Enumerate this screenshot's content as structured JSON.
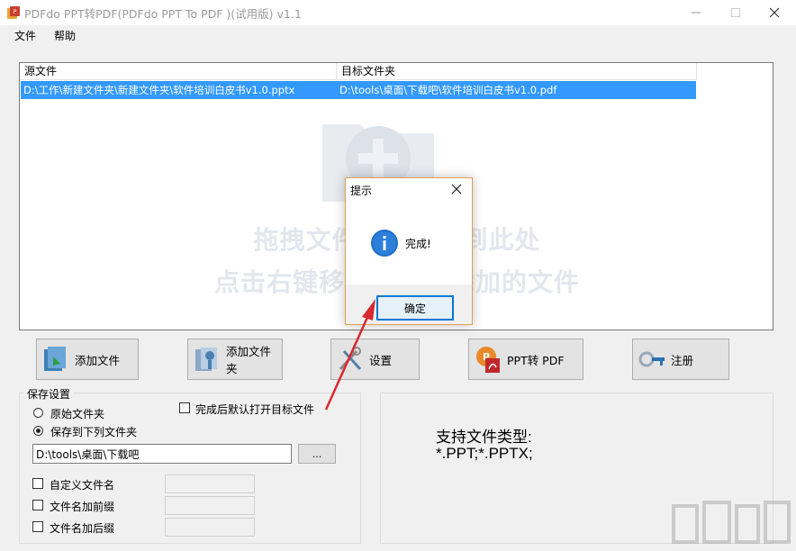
{
  "window": {
    "title": "PDFdo PPT转PDF(PDFdo PPT To PDF )(试用版) v1.1"
  },
  "menu": [
    "文件",
    "帮助"
  ],
  "table": {
    "columns": [
      "源文件",
      "目标文件夹"
    ],
    "rows": [
      {
        "source": "D:\\工作\\新建文件夹\\新建文件夹\\软件培训白皮书v1.0.pptx",
        "target": "D:\\tools\\桌面\\下载吧\\软件培训白皮书v1.0.pdf"
      }
    ]
  },
  "drop_hint": [
    "拖拽文件或文件夹到此处",
    "点击右键移除或清空添加的文件"
  ],
  "toolbar": {
    "add_file": "添加文件",
    "add_folder": "添加文件夹",
    "settings": "设置",
    "convert": "PPT转 PDF",
    "register": "注册"
  },
  "save_settings": {
    "title": "保存设置",
    "option_original": "原始文件夹",
    "option_custom": "保存到下列文件夹",
    "selected": "custom",
    "open_after": "完成后默认打开目标文件",
    "path": "D:\\tools\\桌面\\下载吧",
    "browse": "...",
    "custom_name": "自定义文件名",
    "prefix": "文件名加前缀",
    "suffix": "文件名加后缀"
  },
  "supported": {
    "label": "支持文件类型:",
    "types": "*.PPT;*.PPTX;"
  },
  "dialog": {
    "title": "提示",
    "message": "完成!",
    "ok": "确定"
  },
  "colors": {
    "selection": "#3399ff",
    "accent": "#0078d7",
    "arrow": "#d9282f"
  }
}
